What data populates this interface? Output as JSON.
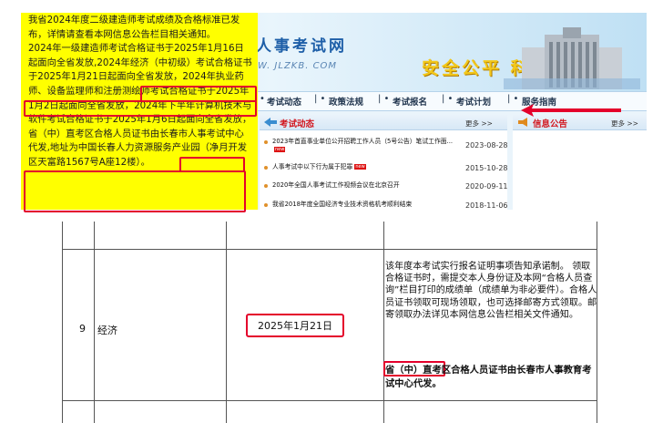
{
  "site": {
    "name": "人事考试网",
    "url": "W. JLZKB. COM",
    "slogan": "安全公平 科学规范",
    "nav": [
      "考试动态",
      "政策法规",
      "考试报名",
      "考试计划",
      "服务指南"
    ],
    "news_panel": {
      "title": "考试动态",
      "more": "更多 >>",
      "items": [
        {
          "title": "2023年首直事业单位公开招聘工作人员（5号公告）笔试工作面...",
          "date": "2023-08-28",
          "new": true
        },
        {
          "title": "人事考试中以下行为属于犯罪",
          "date": "2015-10-28",
          "new": true
        },
        {
          "title": "2020年全国人事考试工作视频会议在北京召开",
          "date": "2020-09-11",
          "new": false
        },
        {
          "title": "我省2018年度全国经济专业技术资格机考顺利结束",
          "date": "2018-11-06",
          "new": false
        }
      ]
    },
    "notice_panel": {
      "title": "信息公告",
      "more": "更多 >>"
    }
  },
  "popup": {
    "text": "我省2024年度二级建造师考试成绩及合格标准已发布，详情请查看本网信息公告栏目相关通知。\n2024年一级建造师考试合格证书于2025年1月16日起面向全省发放,2024年经济（中初级）考试合格证书于2025年1月21日起面向全省发放，2024年执业药师、设备监理师和注册测绘师考试合格证书于2025年1月2日起面向全省发放，2024年下半年计算机技术与软件考试合格证书于2025年1月6日起面向全省发放，省（中）直考区合格人员证书由长春市人事考试中心代发,地址为中国长春人力资源服务产业园（净月开发区天富路1567号A座12楼）。"
  },
  "table": {
    "row": {
      "number": "9",
      "subject": "经济",
      "date": "2025年1月21日",
      "notes": "该年度本考试实行报名证明事项告知承诺制。 领取合格证书时，需提交本人身份证及本网“合格人员查询”栏目打印的成绩单（成绩单为非必要件）。合格人员证书领取可现场领取，也可选择邮寄方式领取。邮寄领取办法详见本网信息公告栏相关文件通知。",
      "direct_note": "省（中）直考区合格人员证书由长春市人事教育考试中心代发。"
    }
  },
  "colors": {
    "highlight": "#e4002b",
    "popup_bg": "#ffff00",
    "accent": "#d2161e"
  }
}
